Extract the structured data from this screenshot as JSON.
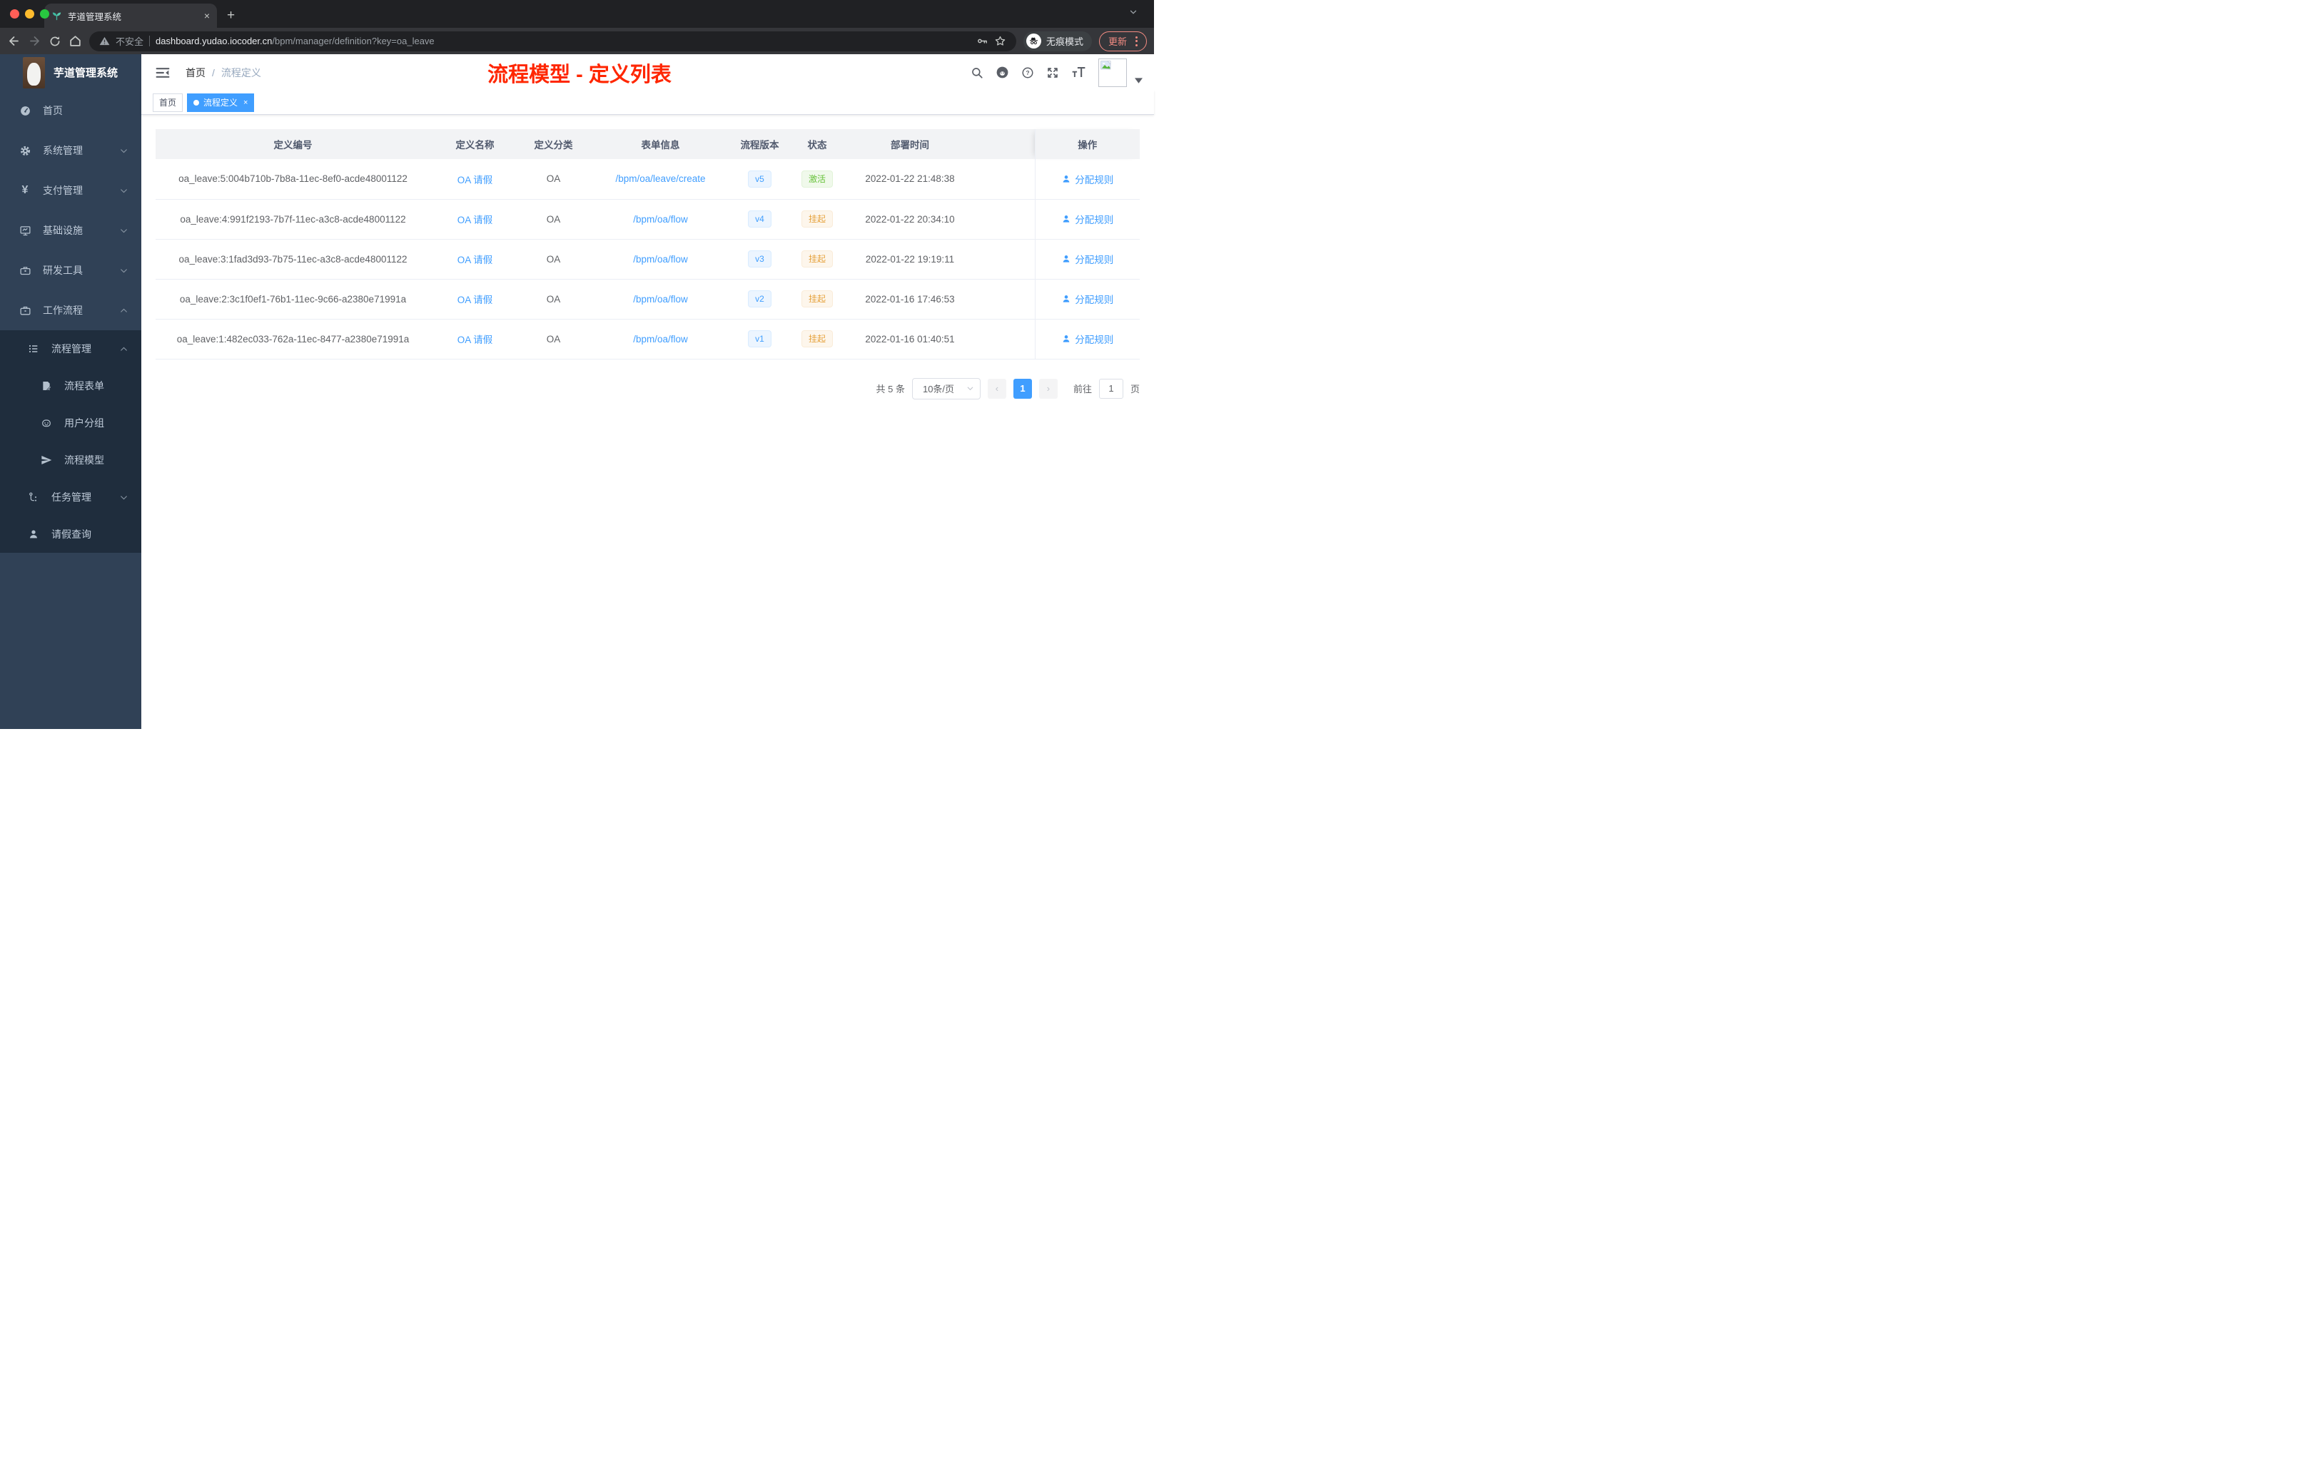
{
  "colors": {
    "accent": "#409eff",
    "red": "#ff2600",
    "sidebarBg": "#304156",
    "submenuBg": "#1f2d3d",
    "success": "#67c23a",
    "successBg": "#f0f9eb",
    "successBorder": "#e1f3d8",
    "warning": "#e6a23c",
    "warningBg": "#fdf6ec",
    "warningBorder": "#faecd8",
    "tagBlueBg": "#ecf5ff",
    "tagBlueBorder": "#d9ecff"
  },
  "browser": {
    "tab_title": "芋道管理系统",
    "close_tab_label": "×",
    "new_tab_label": "+",
    "security_label": "不安全",
    "url_domain": "dashboard.yudao.iocoder.cn",
    "url_path": "/bpm/manager/definition?key=oa_leave",
    "incognito_label": "无痕模式",
    "update_label": "更新"
  },
  "header": {
    "logo_title": "芋道管理系统",
    "breadcrumb": {
      "home": "首页",
      "separator": "/",
      "current": "流程定义"
    },
    "annotation": "流程模型 - 定义列表"
  },
  "sidebar": {
    "items": [
      {
        "label": "首页",
        "icon": "dashboard-icon"
      },
      {
        "label": "系统管理",
        "icon": "gear-icon"
      },
      {
        "label": "支付管理",
        "icon": "yen-icon"
      },
      {
        "label": "基础设施",
        "icon": "monitor-icon"
      },
      {
        "label": "研发工具",
        "icon": "toolbox-icon"
      },
      {
        "label": "工作流程",
        "icon": "briefcase-icon"
      }
    ],
    "workflow_submenu": [
      {
        "label": "流程管理",
        "icon": "list-icon"
      },
      {
        "label": "流程表单",
        "icon": "form-icon"
      },
      {
        "label": "用户分组",
        "icon": "robot-icon"
      },
      {
        "label": "流程模型",
        "icon": "paper-plane-icon"
      },
      {
        "label": "任务管理",
        "icon": "flow-icon"
      },
      {
        "label": "请假查询",
        "icon": "person-icon"
      }
    ]
  },
  "tags_view": [
    {
      "label": "首页",
      "active": false
    },
    {
      "label": "流程定义",
      "active": true,
      "close_label": "×"
    }
  ],
  "table": {
    "columns": [
      "定义编号",
      "定义名称",
      "定义分类",
      "表单信息",
      "流程版本",
      "状态",
      "部署时间",
      "操作"
    ],
    "rows": [
      {
        "id": "oa_leave:5:004b710b-7b8a-11ec-8ef0-acde48001122",
        "name": "OA 请假",
        "category": "OA",
        "form": "/bpm/oa/leave/create",
        "version": "v5",
        "status": "激活",
        "status_type": "success",
        "deploy_time": "2022-01-22 21:48:38",
        "action": "分配规则"
      },
      {
        "id": "oa_leave:4:991f2193-7b7f-11ec-a3c8-acde48001122",
        "name": "OA 请假",
        "category": "OA",
        "form": "/bpm/oa/flow",
        "version": "v4",
        "status": "挂起",
        "status_type": "warning",
        "deploy_time": "2022-01-22 20:34:10",
        "action": "分配规则"
      },
      {
        "id": "oa_leave:3:1fad3d93-7b75-11ec-a3c8-acde48001122",
        "name": "OA 请假",
        "category": "OA",
        "form": "/bpm/oa/flow",
        "version": "v3",
        "status": "挂起",
        "status_type": "warning",
        "deploy_time": "2022-01-22 19:19:11",
        "action": "分配规则"
      },
      {
        "id": "oa_leave:2:3c1f0ef1-76b1-11ec-9c66-a2380e71991a",
        "name": "OA 请假",
        "category": "OA",
        "form": "/bpm/oa/flow",
        "version": "v2",
        "status": "挂起",
        "status_type": "warning",
        "deploy_time": "2022-01-16 17:46:53",
        "action": "分配规则"
      },
      {
        "id": "oa_leave:1:482ec033-762a-11ec-8477-a2380e71991a",
        "name": "OA 请假",
        "category": "OA",
        "form": "/bpm/oa/flow",
        "version": "v1",
        "status": "挂起",
        "status_type": "warning",
        "deploy_time": "2022-01-16 01:40:51",
        "action": "分配规则"
      }
    ]
  },
  "pagination": {
    "total_label": "共 5 条",
    "page_size": "10条/页",
    "prev_label": "‹",
    "current_page": "1",
    "next_label": "›",
    "goto_label": "前往",
    "goto_value": "1",
    "page_label": "页"
  }
}
